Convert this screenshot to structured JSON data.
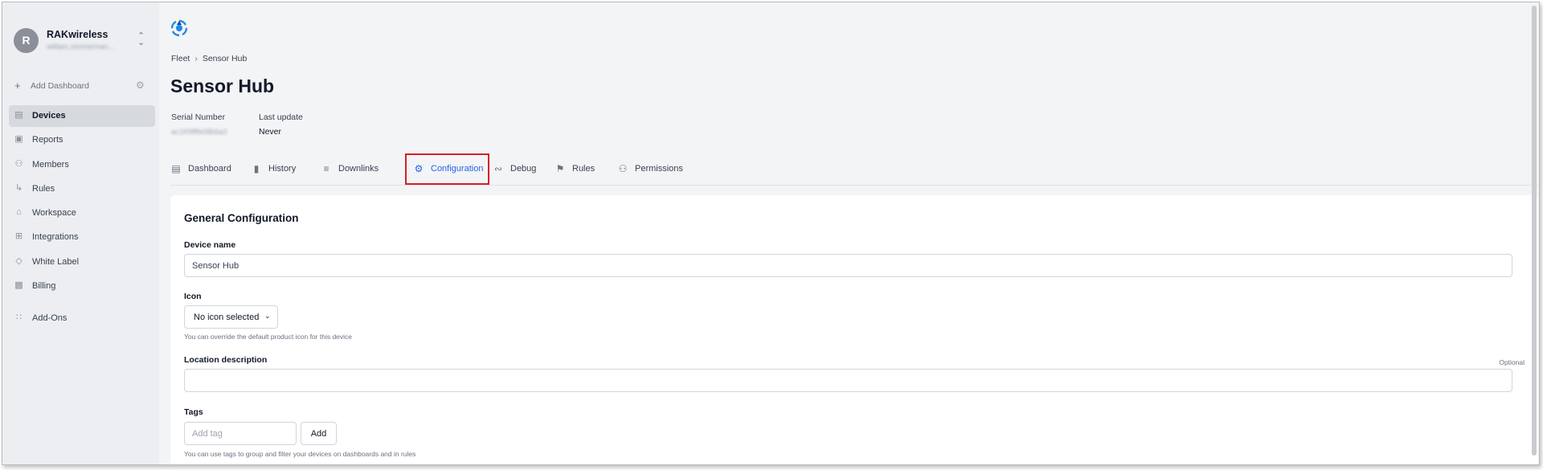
{
  "org": {
    "avatar_letter": "R",
    "name": "RAKwireless",
    "email": "william.zimmerman..."
  },
  "sidebar": {
    "add_dashboard_label": "Add Dashboard",
    "items": [
      {
        "label": "Devices",
        "icon": "devices-icon",
        "active": true
      },
      {
        "label": "Reports",
        "icon": "document-icon"
      },
      {
        "label": "Members",
        "icon": "users-icon"
      },
      {
        "label": "Rules",
        "icon": "rules-icon"
      },
      {
        "label": "Workspace",
        "icon": "workspace-icon"
      },
      {
        "label": "Integrations",
        "icon": "integrations-icon"
      },
      {
        "label": "White Label",
        "icon": "tag-icon"
      },
      {
        "label": "Billing",
        "icon": "billing-icon"
      },
      {
        "label": "Add-Ons",
        "icon": "addons-icon"
      }
    ]
  },
  "breadcrumb": {
    "parent": "Fleet",
    "current": "Sensor Hub"
  },
  "page": {
    "title": "Sensor Hub",
    "serial_label": "Serial Number",
    "serial_value": "ac1f09fffe08b6a3",
    "last_update_label": "Last update",
    "last_update_value": "Never"
  },
  "tabs": [
    {
      "label": "Dashboard",
      "icon": "dashboard-icon"
    },
    {
      "label": "History",
      "icon": "bar-chart-icon"
    },
    {
      "label": "Downlinks",
      "icon": "sliders-icon"
    },
    {
      "label": "Configuration",
      "icon": "gear-icon",
      "active": true
    },
    {
      "label": "Debug",
      "icon": "rss-icon"
    },
    {
      "label": "Rules",
      "icon": "rules-icon"
    },
    {
      "label": "Permissions",
      "icon": "users-icon"
    }
  ],
  "config": {
    "section_title": "General Configuration",
    "device_name_label": "Device name",
    "device_name_value": "Sensor Hub",
    "icon_label": "Icon",
    "icon_select_value": "No icon selected",
    "icon_help": "You can override the default product icon for this device",
    "location_label": "Location description",
    "location_optional": "Optional",
    "location_value": "",
    "tags_label": "Tags",
    "tags_placeholder": "Add tag",
    "tags_add_button": "Add",
    "tags_help": "You can use tags to group and filter your devices on dashboards and in rules"
  },
  "colors": {
    "accent": "#2563eb",
    "highlight_box": "#d3202a",
    "sidebar_bg": "#eceef1",
    "main_bg": "#f3f4f6"
  }
}
